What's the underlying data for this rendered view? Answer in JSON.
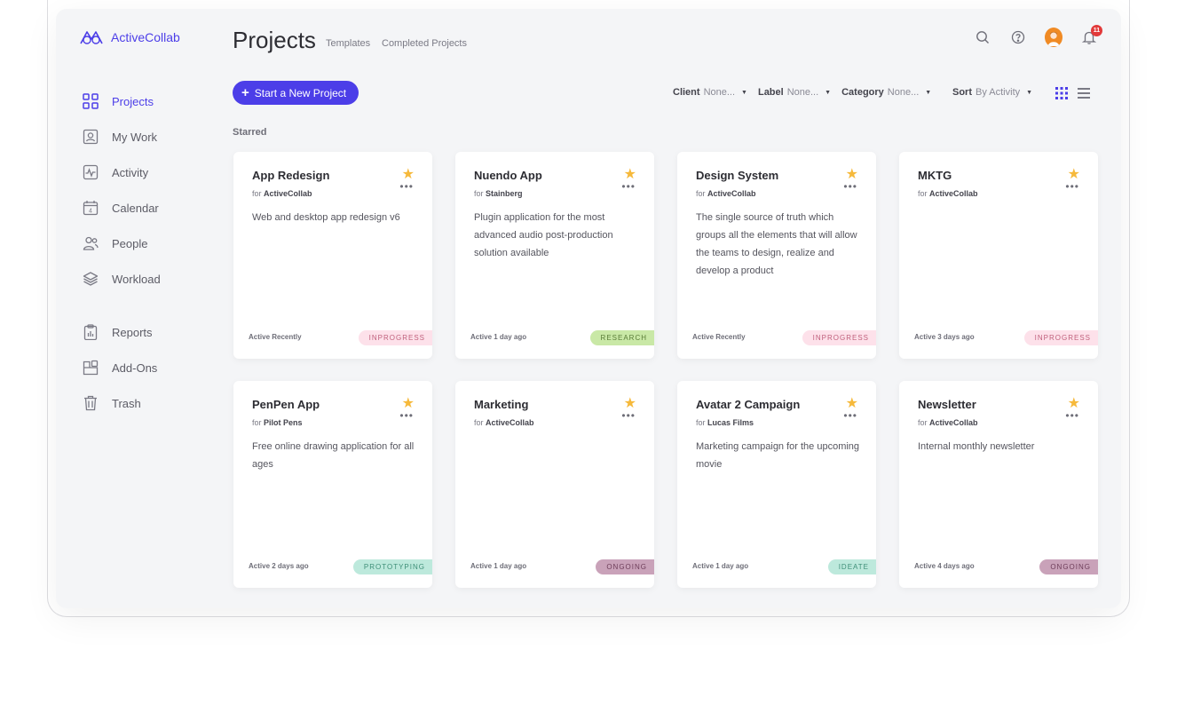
{
  "app": {
    "logo_text": "ActiveCollab",
    "accent": "#4c3ee8"
  },
  "sidebar": {
    "items": [
      {
        "key": "projects",
        "label": "Projects",
        "icon": "grid-icon",
        "active": true
      },
      {
        "key": "my-work",
        "label": "My Work",
        "icon": "user-card-icon"
      },
      {
        "key": "activity",
        "label": "Activity",
        "icon": "activity-icon"
      },
      {
        "key": "calendar",
        "label": "Calendar",
        "icon": "calendar-icon",
        "day": "4"
      },
      {
        "key": "people",
        "label": "People",
        "icon": "people-icon"
      },
      {
        "key": "workload",
        "label": "Workload",
        "icon": "layers-icon"
      },
      {
        "key": "reports",
        "label": "Reports",
        "icon": "clipboard-chart-icon"
      },
      {
        "key": "add-ons",
        "label": "Add-Ons",
        "icon": "add-ons-icon"
      },
      {
        "key": "trash",
        "label": "Trash",
        "icon": "trash-icon"
      }
    ]
  },
  "header": {
    "title": "Projects",
    "links": [
      "Templates",
      "Completed Projects"
    ],
    "notification_count": "11"
  },
  "toolbar": {
    "new_project_label": "Start a New Project",
    "filters": [
      {
        "label": "Client",
        "value": "None..."
      },
      {
        "label": "Label",
        "value": "None..."
      },
      {
        "label": "Category",
        "value": "None..."
      }
    ],
    "sort": {
      "label": "Sort",
      "value": "By Activity"
    }
  },
  "section_label": "Starred",
  "projects": [
    {
      "title": "App Redesign",
      "for": "for",
      "client": "ActiveCollab",
      "description": "Web and desktop app redesign v6",
      "activity": "Active Recently",
      "label": "INPROGRESS",
      "label_bg": "#fde1ea",
      "label_fg": "#c0607c"
    },
    {
      "title": "Nuendo App",
      "for": "for",
      "client": "Stainberg",
      "description": "Plugin application for the most advanced audio post-production solution available",
      "activity": "Active 1 day ago",
      "label": "RESEARCH",
      "label_bg": "#c9e8a6",
      "label_fg": "#5a7d38"
    },
    {
      "title": "Design System",
      "for": "for",
      "client": "ActiveCollab",
      "description": "The single source of truth which groups all the elements that will allow the teams to design, realize and develop a product",
      "activity": "Active Recently",
      "label": "INPROGRESS",
      "label_bg": "#fde1ea",
      "label_fg": "#c0607c"
    },
    {
      "title": "MKTG",
      "for": "for",
      "client": "ActiveCollab",
      "description": "",
      "activity": "Active 3 days ago",
      "label": "INPROGRESS",
      "label_bg": "#fde1ea",
      "label_fg": "#c0607c"
    },
    {
      "title": "PenPen App",
      "for": "for",
      "client": "Pilot Pens",
      "description": "Free online drawing application for all ages",
      "activity": "Active 2 days ago",
      "label": "PROTOTYPING",
      "label_bg": "#bde9dc",
      "label_fg": "#3f8f78"
    },
    {
      "title": "Marketing",
      "for": "for",
      "client": "ActiveCollab",
      "description": "",
      "activity": "Active 1 day ago",
      "label": "ONGOING",
      "label_bg": "#c9a2b9",
      "label_fg": "#6e3e5a"
    },
    {
      "title": "Avatar 2 Campaign",
      "for": "for",
      "client": "Lucas Films",
      "description": "Marketing campaign for the upcoming movie",
      "activity": "Active 1 day ago",
      "label": "IDEATE",
      "label_bg": "#bde9dc",
      "label_fg": "#3f8f78"
    },
    {
      "title": "Newsletter",
      "for": "for",
      "client": "ActiveCollab",
      "description": "Internal monthly newsletter",
      "activity": "Active 4 days ago",
      "label": "ONGOING",
      "label_bg": "#c9a2b9",
      "label_fg": "#6e3e5a"
    }
  ]
}
